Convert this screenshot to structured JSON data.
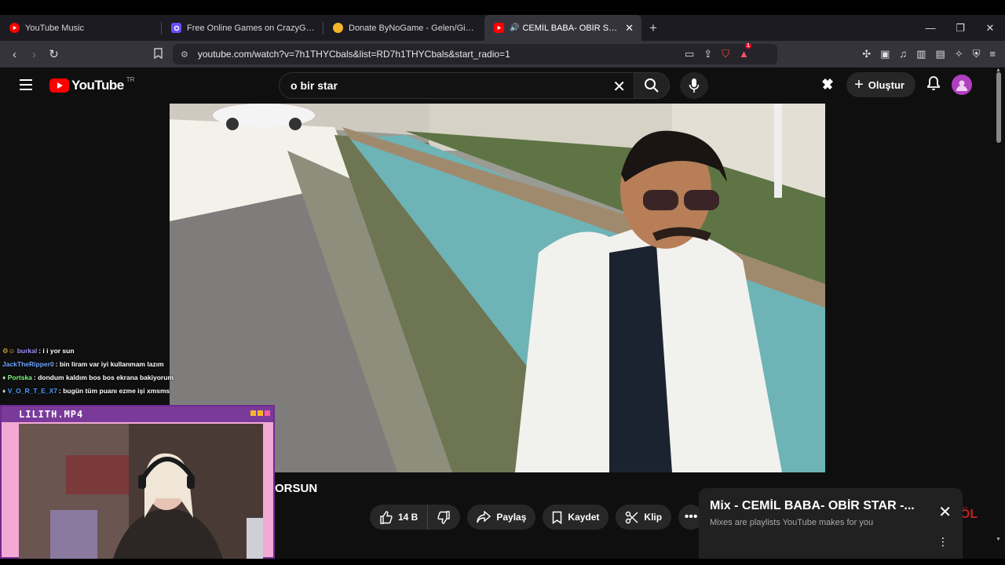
{
  "browser": {
    "tabs": [
      {
        "title": "YouTube Music",
        "favicon": "youtube-music-icon",
        "color": "#ff0000",
        "active": false
      },
      {
        "title": "Free Online Games on CrazyGames |",
        "favicon": "crazygames-icon",
        "color": "#6a4cff",
        "active": false
      },
      {
        "title": "Donate ByNoGame - Gelen/Giden Ba",
        "favicon": "bynogame-icon",
        "color": "#f5b52a",
        "active": false
      },
      {
        "title": "CEMİL BABA- OBİR STAR -CA",
        "favicon": "youtube-icon",
        "color": "#ff0000",
        "active": true
      }
    ],
    "url": "youtube.com/watch?v=7h1THYCbals&list=RD7h1THYCbals&start_radio=1",
    "brave_badge": "1"
  },
  "youtube": {
    "logo_text": "YouTube",
    "country_code": "TR",
    "search_query": "o bir star",
    "create_label": "Oluştur",
    "title_fragment": "ORSUN",
    "actions": {
      "like_count": "14 B",
      "share_label": "Paylaş",
      "save_label": "Kaydet",
      "clip_label": "Klip"
    },
    "mix": {
      "title": "Mix - CEMİL BABA- OBİR STAR -...",
      "subtitle": "Mixes are playlists YouTube makes for you"
    }
  },
  "stream_overlay": {
    "chat": [
      {
        "user": "burkal",
        "message": ": i i yor sun",
        "color": "#9b8ffa"
      },
      {
        "user": "JackTheRipper0",
        "message": ": bin liram var iyi kullanmam lazım",
        "color": "#6fa8ff"
      },
      {
        "user": "Portska",
        "message": ": dondum kaldım bos bos ekrana bakiyorum",
        "color": "#7dff7d"
      },
      {
        "user": "V_O_R_T_E_X7",
        "message": ": bugün tüm puanı ezme işi xmsms",
        "color": "#4f9cff"
      }
    ],
    "cam_title": "LILITH.MP4"
  }
}
